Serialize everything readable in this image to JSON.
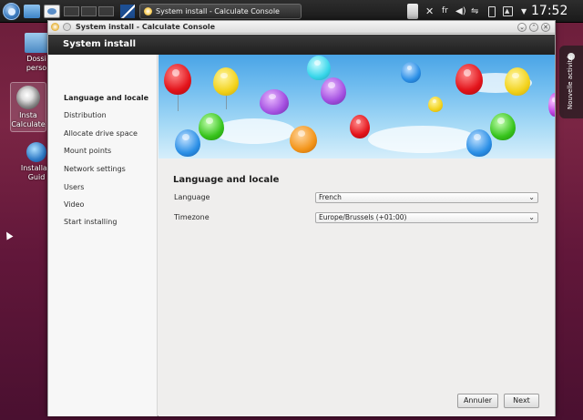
{
  "taskbar": {
    "window_button_label": "System install - Calculate Console",
    "tray": {
      "x_icon": "✕",
      "keyboard_layout": "fr",
      "volume_icon": "◀)",
      "network_icon": "⇋"
    },
    "clock": "17:52"
  },
  "desktop": {
    "icons": [
      {
        "label": "Dossier personnel",
        "line1": "Dossi",
        "line2": "perso"
      },
      {
        "label": "Installer Calculate",
        "line1": "Insta",
        "line2": "Calculate"
      },
      {
        "label": "Installation Guide",
        "line1": "Installati",
        "line2": "Guid"
      }
    ],
    "side_widget_label": "Nouvelle activité"
  },
  "window": {
    "title": "System install - Calculate Console",
    "header": "System install",
    "controls": {
      "minimize": "⌄",
      "maximize": "⌃",
      "close": "✕"
    }
  },
  "sidebar": {
    "items": [
      {
        "label": "Language and locale",
        "active": true
      },
      {
        "label": "Distribution",
        "active": false
      },
      {
        "label": "Allocate drive space",
        "active": false
      },
      {
        "label": "Mount points",
        "active": false
      },
      {
        "label": "Network settings",
        "active": false
      },
      {
        "label": "Users",
        "active": false
      },
      {
        "label": "Video",
        "active": false
      },
      {
        "label": "Start installing",
        "active": false
      }
    ]
  },
  "main": {
    "section_title": "Language and locale",
    "fields": [
      {
        "label": "Language",
        "value": "French"
      },
      {
        "label": "Timezone",
        "value": "Europe/Brussels (+01:00)"
      }
    ],
    "dropdown_icon": "⌄"
  },
  "footer": {
    "cancel_label": "Annuler",
    "next_label": "Next"
  },
  "colors": {
    "header_bg": "#262626",
    "sky_top": "#4aa4e6",
    "desktop_bg": "#6b1d3a"
  }
}
